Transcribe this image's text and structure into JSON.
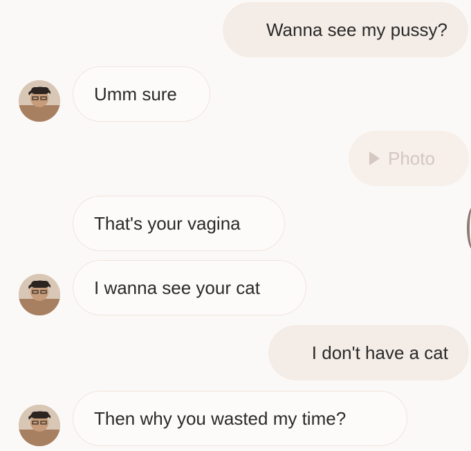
{
  "messages": [
    {
      "text": "Wanna see my pussy?"
    },
    {
      "text": "Umm sure"
    },
    {
      "text": "Photo"
    },
    {
      "text": "That's your vagina"
    },
    {
      "text": "I wanna see your cat"
    },
    {
      "text": "I don't have a cat"
    },
    {
      "text": "Then why you wasted my time?"
    }
  ],
  "colors": {
    "sent_bubble": "#f4ece6",
    "received_bubble": "#fdfbfa",
    "received_border": "#efe3db",
    "background": "#fbf9f7"
  },
  "icons": {
    "photo": "play-icon",
    "contact": "avatar"
  }
}
